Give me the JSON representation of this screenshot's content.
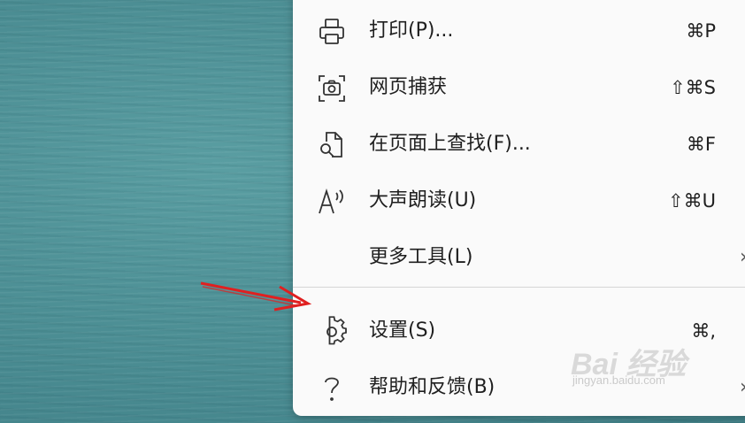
{
  "menu": {
    "items": [
      {
        "label": "打印(P)...",
        "shortcut": "⌘P",
        "icon": "printer-icon"
      },
      {
        "label": "网页捕获",
        "shortcut": "⇧⌘S",
        "icon": "screenshot-capture-icon"
      },
      {
        "label": "在页面上查找(F)...",
        "shortcut": "⌘F",
        "icon": "find-in-page-icon"
      },
      {
        "label": "大声朗读(U)",
        "shortcut": "⇧⌘U",
        "icon": "read-aloud-icon"
      },
      {
        "label": "更多工具(L)",
        "shortcut": "",
        "icon": "",
        "chevron": "›"
      },
      {
        "label": "设置(S)",
        "shortcut": "⌘,",
        "icon": "gear-icon"
      },
      {
        "label": "帮助和反馈(B)",
        "shortcut": "",
        "icon": "help-question-icon",
        "chevron": "›"
      }
    ]
  },
  "watermark": {
    "logo": "Bai 经验",
    "sub": "jingyan.baidu.com"
  },
  "colors": {
    "menu_bg": "#fafafa",
    "text": "#1f1f1f",
    "arrow": "#e02020",
    "background": "#4a8c92"
  }
}
